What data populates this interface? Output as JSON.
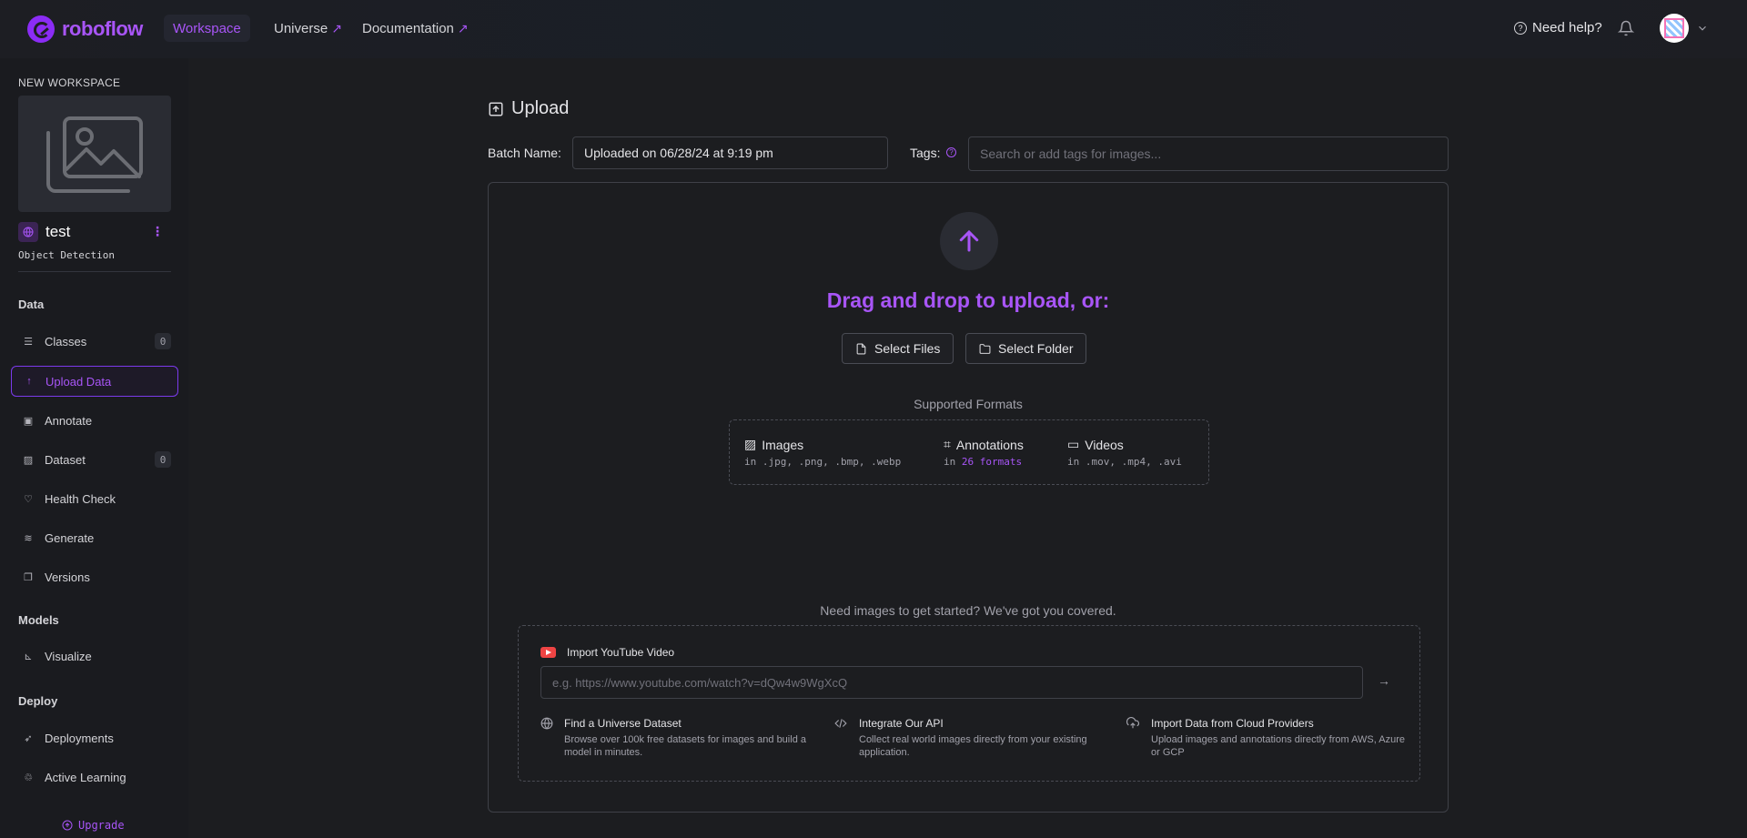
{
  "topbar": {
    "brand": "roboflow",
    "nav": [
      {
        "label": "Workspace",
        "active": true,
        "external": false
      },
      {
        "label": "Universe",
        "active": false,
        "external": true
      },
      {
        "label": "Documentation",
        "active": false,
        "external": true
      }
    ],
    "help_label": "Need help?",
    "accent": "#a855f7"
  },
  "sidebar": {
    "workspace_label": "NEW WORKSPACE",
    "project_name": "test",
    "project_type": "Object Detection",
    "sections": {
      "data": "Data",
      "models": "Models",
      "deploy": "Deploy"
    },
    "items": [
      {
        "label": "Classes",
        "icon": "list-icon",
        "count": "0"
      },
      {
        "label": "Upload Data",
        "icon": "upload-icon",
        "active": true
      },
      {
        "label": "Annotate",
        "icon": "annotate-icon"
      },
      {
        "label": "Dataset",
        "icon": "image-icon",
        "count": "0"
      },
      {
        "label": "Health Check",
        "icon": "heart-icon"
      },
      {
        "label": "Generate",
        "icon": "layers-icon"
      },
      {
        "label": "Versions",
        "icon": "versions-icon"
      },
      {
        "label": "Visualize",
        "icon": "chart-icon"
      },
      {
        "label": "Deployments",
        "icon": "rocket-icon"
      },
      {
        "label": "Active Learning",
        "icon": "recycle-icon"
      }
    ],
    "upgrade_label": "Upgrade"
  },
  "main": {
    "title": "Upload",
    "batch_label": "Batch Name:",
    "batch_value": "Uploaded on 06/28/24 at 9:19 pm",
    "tags_label": "Tags:",
    "tags_placeholder": "Search or add tags for images...",
    "dropzone": {
      "title": "Drag and drop to upload, or:",
      "select_files": "Select Files",
      "select_folder": "Select Folder",
      "formats_title": "Supported Formats",
      "formats": [
        {
          "name": "Images",
          "icon": "image-icon",
          "detail": "in .jpg, .png, .bmp, .webp"
        },
        {
          "name": "Annotations",
          "icon": "bounding-box-icon",
          "detail_prefix": "in ",
          "detail_highlight": "26 formats"
        },
        {
          "name": "Videos",
          "icon": "video-icon",
          "detail": "in .mov, .mp4, .avi"
        }
      ]
    },
    "get_started": "Need images to get started? We've got you covered.",
    "youtube": {
      "label": "Import YouTube Video",
      "placeholder": "e.g. https://www.youtube.com/watch?v=dQw4w9WgXcQ"
    },
    "options": [
      {
        "title": "Find a Universe Dataset",
        "desc": "Browse over 100k free datasets for images and build a model in minutes.",
        "icon": "globe-icon"
      },
      {
        "title": "Integrate Our API",
        "desc": "Collect real world images directly from your existing application.",
        "icon": "code-icon"
      },
      {
        "title": "Import Data from Cloud Providers",
        "desc": "Upload images and annotations directly from AWS, Azure or GCP",
        "icon": "cloud-upload-icon"
      }
    ]
  }
}
